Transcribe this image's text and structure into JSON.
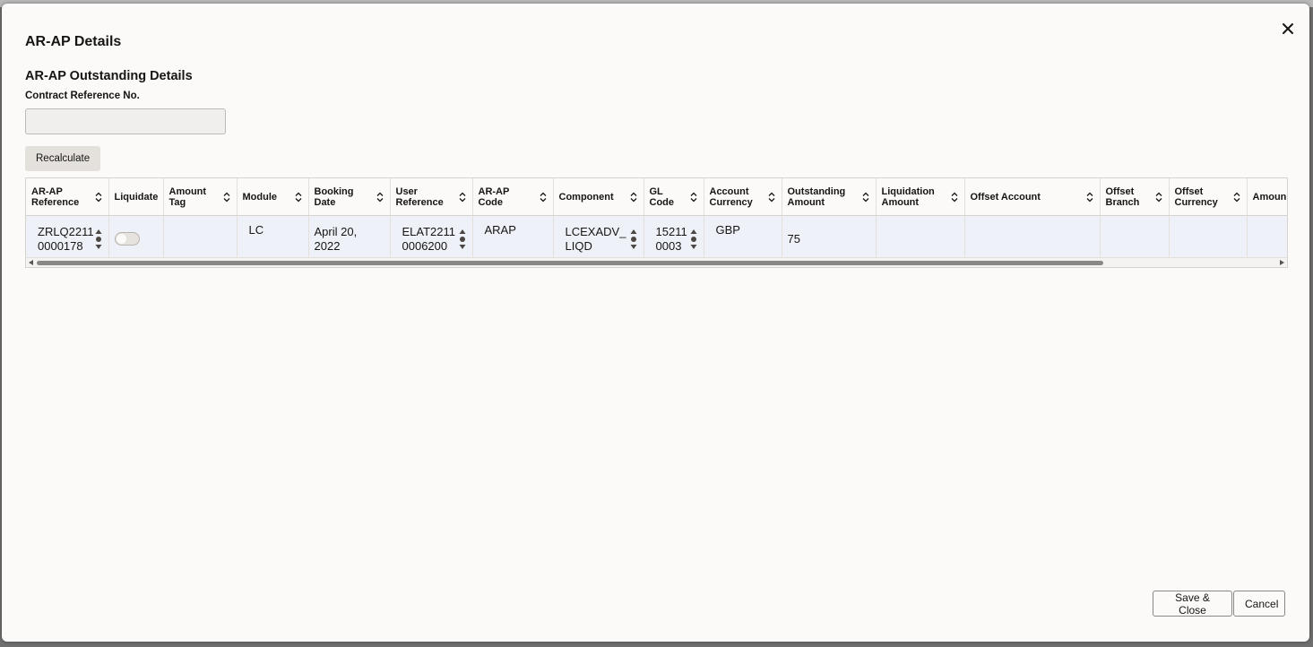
{
  "dialog": {
    "title": "AR-AP Details",
    "section_title": "AR-AP Outstanding Details",
    "contract_label": "Contract Reference No.",
    "contract_value": "",
    "recalculate_label": "Recalculate",
    "save_close_label": "Save & Close",
    "cancel_label": "Cancel"
  },
  "table": {
    "headers": {
      "ar_ap_reference": [
        "AR-AP",
        "Reference"
      ],
      "liquidate": [
        "Liquidate"
      ],
      "amount_tag": [
        "Amount",
        "Tag"
      ],
      "module": [
        "Module"
      ],
      "booking_date": [
        "Booking",
        "Date"
      ],
      "user_reference": [
        "User",
        "Reference"
      ],
      "ar_ap_code": [
        "AR-AP",
        "Code"
      ],
      "component": [
        "Component"
      ],
      "gl_code": [
        "GL",
        "Code"
      ],
      "account_currency": [
        "Account",
        "Currency"
      ],
      "outstanding_amount": [
        "Outstanding",
        "Amount"
      ],
      "liquidation_amount": [
        "Liquidation",
        "Amount"
      ],
      "offset_account": [
        "Offset Account"
      ],
      "offset_branch": [
        "Offset",
        "Branch"
      ],
      "offset_currency": [
        "Offset",
        "Currency"
      ],
      "amount": [
        "Amoun"
      ]
    },
    "row": {
      "ar_ap_reference": [
        "ZRLQ2211",
        "0000178"
      ],
      "liquidate": false,
      "amount_tag": "",
      "module": "LC",
      "booking_date": "April 20, 2022",
      "user_reference": [
        "ELAT2211",
        "0006200"
      ],
      "ar_ap_code": "ARAP",
      "component": [
        "LCEXADV_",
        "LIQD"
      ],
      "gl_code": [
        "15211",
        "0003"
      ],
      "account_currency": "GBP",
      "outstanding_amount": "75",
      "liquidation_amount": "",
      "offset_account": "",
      "offset_branch": "",
      "offset_currency": "",
      "amount": ""
    }
  },
  "icons": {
    "close": "close-icon",
    "sort": "sort-icon",
    "spinner": "spinner-icon"
  }
}
